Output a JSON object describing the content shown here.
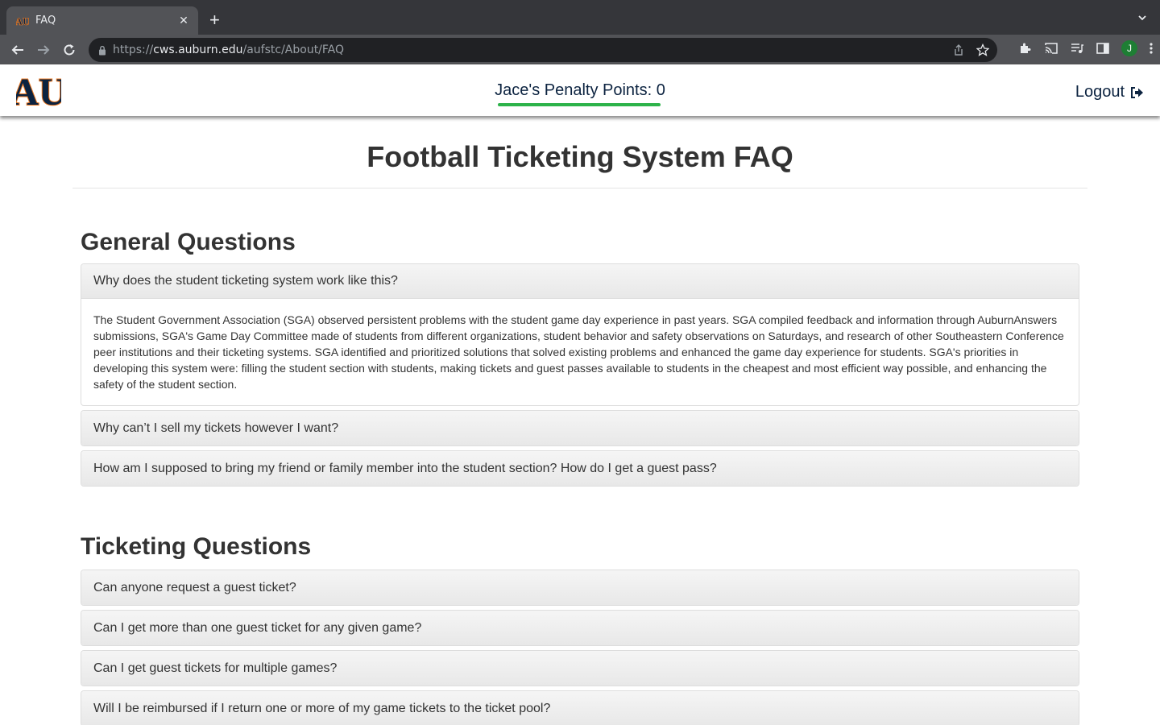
{
  "browser": {
    "tab_title": "FAQ",
    "url_scheme": "https://",
    "url_host": "cws.auburn.edu",
    "url_path": "/aufstc/About/FAQ",
    "profile_initial": "J"
  },
  "header": {
    "penalty_text": "Jace's Penalty Points: 0",
    "logout_label": "Logout"
  },
  "page": {
    "title": "Football Ticketing System FAQ"
  },
  "sections": [
    {
      "title": "General Questions",
      "items": [
        {
          "question": "Why does the student ticketing system work like this?",
          "answer": "The Student Government Association (SGA) observed persistent problems with the student game day experience in past years. SGA compiled feedback and information through AuburnAnswers submissions, SGA's Game Day Committee made of students from different organizations, student behavior and safety observations on Saturdays, and research of other Southeastern Conference peer institutions and their ticketing systems. SGA identified and prioritized solutions that solved existing problems and enhanced the game day experience for students. SGA's priorities in developing this system were: filling the student section with students, making tickets and guest passes available to students in the cheapest and most efficient way possible, and enhancing the safety of the student section."
        },
        {
          "question": "Why can’t I sell my tickets however I want?"
        },
        {
          "question": "How am I supposed to bring my friend or family member into the student section? How do I get a guest pass?"
        }
      ]
    },
    {
      "title": "Ticketing Questions",
      "items": [
        {
          "question": "Can anyone request a guest ticket?"
        },
        {
          "question": "Can I get more than one guest ticket for any given game?"
        },
        {
          "question": "Can I get guest tickets for multiple games?"
        },
        {
          "question": "Will I be reimbursed if I return one or more of my game tickets to the ticket pool?"
        }
      ]
    }
  ],
  "colors": {
    "navy": "#0c2340",
    "orange": "#e87722",
    "accent_green": "#2db34a"
  }
}
